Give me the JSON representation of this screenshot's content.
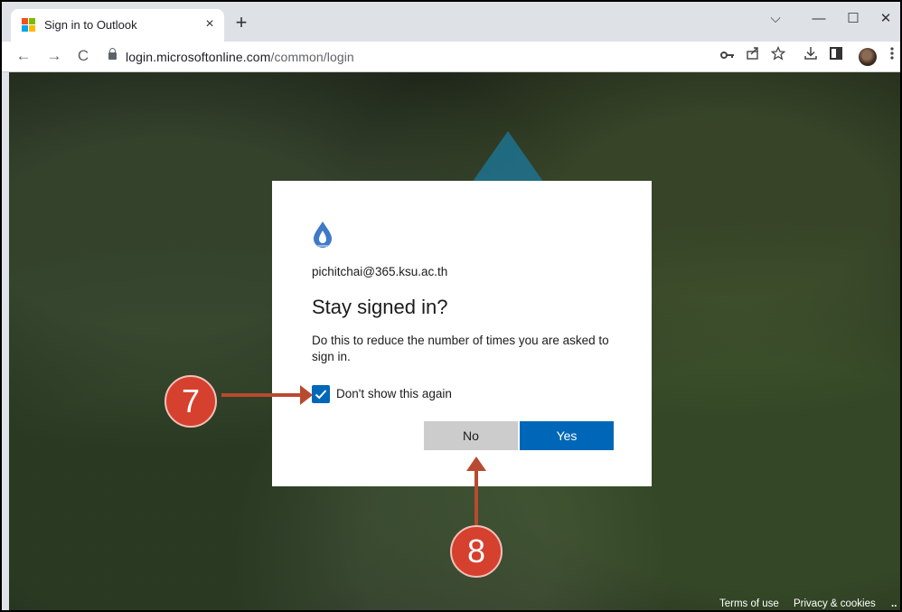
{
  "browser": {
    "tab_title": "Sign in to Outlook",
    "tab_close": "×",
    "new_tab": "+",
    "url_host": "login.microsoftonline.com",
    "url_path": "/common/login",
    "window_controls": {
      "dropdown": "⌵",
      "minimize": "—",
      "maximize": "☐",
      "close": "✕"
    },
    "nav": {
      "back": "←",
      "forward": "→",
      "reload": "C"
    },
    "toolbar_icons": [
      "key-icon",
      "share-icon",
      "star-icon",
      "download-icon",
      "sidepanel-icon",
      "profile-avatar",
      "menu-icon"
    ]
  },
  "dialog": {
    "email": "pichitchai@365.ksu.ac.th",
    "heading": "Stay signed in?",
    "description": "Do this to reduce the number of times you are asked to sign in.",
    "checkbox_label": "Don't show this again",
    "checkbox_checked": true,
    "no_label": "No",
    "yes_label": "Yes"
  },
  "footer": {
    "terms": "Terms of use",
    "privacy": "Privacy & cookies",
    "more": ".."
  },
  "annotations": {
    "step_7": "7",
    "step_8": "8"
  },
  "colors": {
    "accent": "#0067b8",
    "no_button": "#cccccc",
    "marker": "#d6402e"
  }
}
